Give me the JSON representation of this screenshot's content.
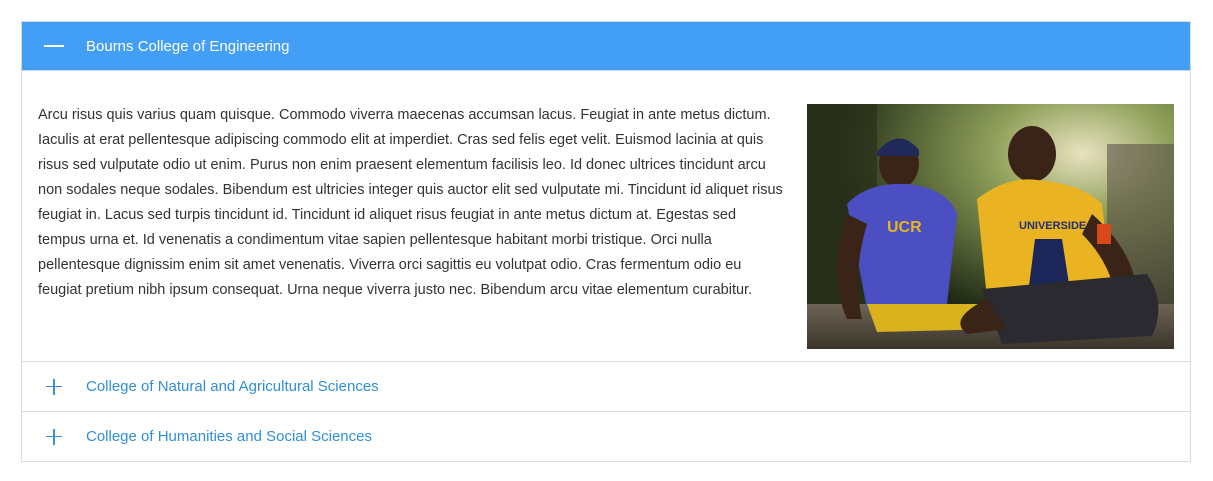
{
  "accordion": {
    "open_item": {
      "title": "Bourns College of Engineering",
      "icon": "minus-icon",
      "body": "Arcu risus quis varius quam quisque. Commodo viverra maecenas accumsan lacus. Feugiat in ante metus dictum. Iaculis at erat pellentesque adipiscing commodo elit at imperdiet. Cras sed felis eget velit. Euismod lacinia at quis risus sed vulputate odio ut enim. Purus non enim praesent elementum facilisis leo. Id donec ultrices tincidunt arcu non sodales neque sodales. Bibendum est ultricies integer quis auctor elit sed vulputate mi. Tincidunt id aliquet risus feugiat in. Lacus sed turpis tincidunt id. Tincidunt id aliquet risus feugiat in ante metus dictum at. Egestas sed tempus urna et. Id venenatis a condimentum vitae sapien pellentesque habitant morbi tristique. Orci nulla pellentesque dignissim enim sit amet venenatis. Viverra orci sagittis eu volutpat odio. Cras fermentum odio eu feugiat pretium nibh ipsum consequat. Urna neque viverra justo nec. Bibendum arcu vitae elementum curabitur.",
      "photo_shirt_text_left": "UCR",
      "photo_shirt_text_right": "UNIVERSIDE"
    },
    "closed_items": [
      {
        "title": "College of Natural and Agricultural Sciences",
        "icon": "plus-icon"
      },
      {
        "title": "College of Humanities and Social Sciences",
        "icon": "plus-icon"
      }
    ]
  },
  "colors": {
    "accent": "#439ef5",
    "link": "#2f8fd6",
    "text": "#333333",
    "border": "#dcdcdc"
  }
}
